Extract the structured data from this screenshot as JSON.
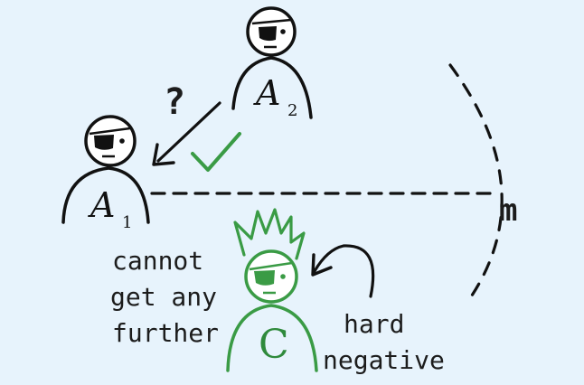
{
  "nodes": {
    "a1": {
      "label": "A",
      "subscript": "1"
    },
    "a2": {
      "label": "A",
      "subscript": "2"
    },
    "c": {
      "label": "C"
    }
  },
  "annotations": {
    "question": "?",
    "margin": "m",
    "cannot_line1": "cannot",
    "cannot_line2": "get any",
    "cannot_line3": "further",
    "hard_line1": "hard",
    "hard_line2": "negative"
  },
  "colors": {
    "background": "#e7f3fc",
    "ink": "#111111",
    "green": "#3a9b45"
  },
  "icons": [
    "eyepatch-head-icon",
    "check-icon",
    "arrow-icon",
    "crown-icon"
  ]
}
